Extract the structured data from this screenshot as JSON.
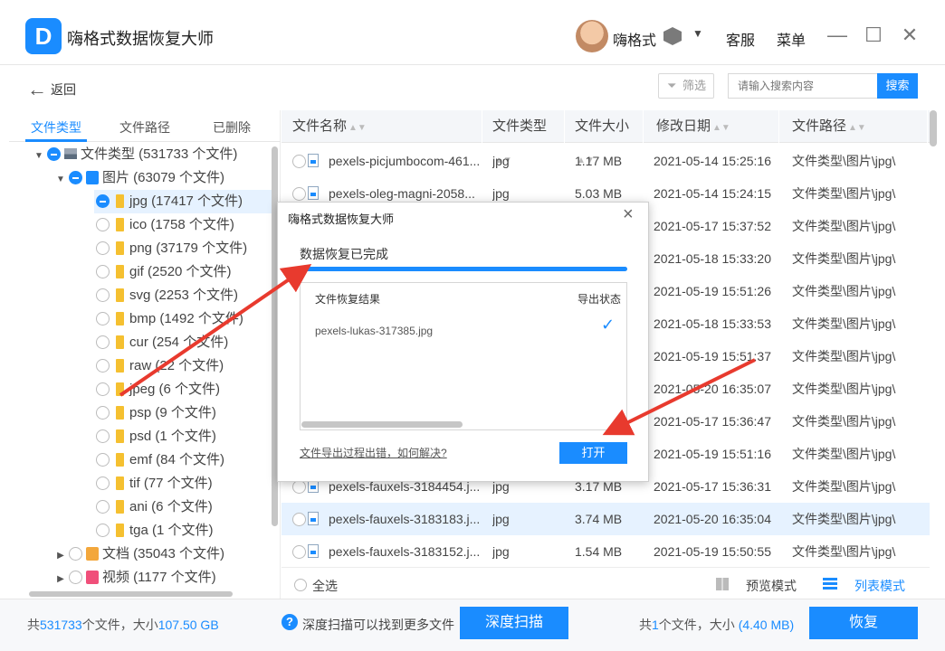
{
  "app": {
    "logo_letter": "D",
    "title": "嗨格式数据恢复大师",
    "username": "嗨格式",
    "links": [
      "客服",
      "菜单"
    ]
  },
  "toolbar": {
    "back_label": "返回",
    "filter_label": "筛选",
    "search_placeholder": "请输入搜索内容",
    "search_button": "搜索"
  },
  "left_tabs": [
    "文件类型",
    "文件路径",
    "已删除"
  ],
  "tree": [
    "文件类型 (531733 个文件)",
    "图片 (63079 个文件)",
    "jpg (17417 个文件)",
    "ico (1758 个文件)",
    "png (37179 个文件)",
    "gif (2520 个文件)",
    "svg (2253 个文件)",
    "bmp (1492 个文件)",
    "cur (254 个文件)",
    "raw (22 个文件)",
    "jpeg (6 个文件)",
    "psp (9 个文件)",
    "psd (1 个文件)",
    "emf (84 个文件)",
    "tif (77 个文件)",
    "ani (6 个文件)",
    "tga (1 个文件)",
    "文档 (35043 个文件)",
    "视频 (1177 个文件)"
  ],
  "table": {
    "columns": [
      "文件名称",
      "文件类型",
      "文件大小",
      "修改日期",
      "文件路径"
    ],
    "rows": [
      [
        "pexels-picjumbocom-461...",
        "jpg",
        "1.17 MB",
        "2021-05-14 15:25:16",
        "文件类型\\图片\\jpg\\"
      ],
      [
        "pexels-oleg-magni-2058...",
        "jpg",
        "5.03 MB",
        "2021-05-14 15:24:15",
        "文件类型\\图片\\jpg\\"
      ],
      [
        "",
        "",
        "",
        "2021-05-17 15:37:52",
        "文件类型\\图片\\jpg\\"
      ],
      [
        "",
        "",
        "",
        "2021-05-18 15:33:20",
        "文件类型\\图片\\jpg\\"
      ],
      [
        "",
        "",
        "",
        "2021-05-19 15:51:26",
        "文件类型\\图片\\jpg\\"
      ],
      [
        "",
        "",
        "",
        "2021-05-18 15:33:53",
        "文件类型\\图片\\jpg\\"
      ],
      [
        "",
        "",
        "",
        "2021-05-19 15:51:37",
        "文件类型\\图片\\jpg\\"
      ],
      [
        "",
        "",
        "",
        "2021-05-20 16:35:07",
        "文件类型\\图片\\jpg\\"
      ],
      [
        "",
        "",
        "",
        "2021-05-17 15:36:47",
        "文件类型\\图片\\jpg\\"
      ],
      [
        "",
        "",
        "",
        "2021-05-19 15:51:16",
        "文件类型\\图片\\jpg\\"
      ],
      [
        "pexels-fauxels-3184454.j...",
        "jpg",
        "3.17 MB",
        "2021-05-17 15:36:31",
        "文件类型\\图片\\jpg\\"
      ],
      [
        "pexels-fauxels-3183183.j...",
        "jpg",
        "3.74 MB",
        "2021-05-20 16:35:04",
        "文件类型\\图片\\jpg\\"
      ],
      [
        "pexels-fauxels-3183152.j...",
        "jpg",
        "1.54 MB",
        "2021-05-19 15:50:55",
        "文件类型\\图片\\jpg\\"
      ]
    ]
  },
  "footer": {
    "select_all": "全选",
    "preview_mode": "预览模式",
    "list_mode": "列表模式"
  },
  "status": {
    "total_prefix": "共",
    "total_count": "531733",
    "total_mid": "个文件，大小",
    "total_size": "107.50 GB",
    "deep_hint": "深度扫描可以找到更多文件",
    "deep_button": "深度扫描",
    "sel_prefix": "共",
    "sel_count": "1",
    "sel_mid": "个文件，大小",
    "sel_size": "(4.40 MB)",
    "recover_button": "恢复"
  },
  "dialog": {
    "title": "嗨格式数据恢复大师",
    "status": "数据恢复已完成",
    "progress": 1.0,
    "col_result": "文件恢复结果",
    "col_status": "导出状态",
    "file": "pexels-lukas-317385.jpg",
    "help_link": "文件导出过程出错，如何解决?",
    "open_button": "打开"
  },
  "colors": {
    "accent": "#1a8cff",
    "arrow": "#e83a2e"
  }
}
